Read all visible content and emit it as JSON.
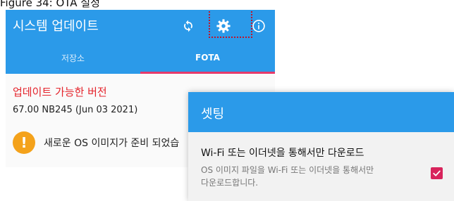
{
  "caption": "Figure 34: OTA 설정",
  "app": {
    "title": "시스템 업데이트",
    "icons": [
      "sync-icon",
      "settings-icon",
      "info-icon"
    ],
    "tabs": [
      {
        "label": "저장소",
        "selected": false
      },
      {
        "label": "FOTA",
        "selected": true
      }
    ],
    "section_title": "업데이트 가능한 버전",
    "version": "67.00 NB245 (Jun 03 2021)",
    "notice": "새로운 OS 이미지가 준비 되었습",
    "notice_icon": "exclamation-icon"
  },
  "dialog": {
    "title": "셋팅",
    "pref_title": "Wi-Fi 또는 이더넷을 통해서만 다운로드",
    "pref_summary_line1": "OS 이미지 파일을 Wi-Fi 또는 이더넷을 통해서만",
    "pref_summary_line2": "다운로드합니다.",
    "checked": true
  },
  "colors": {
    "primary": "#2b9ae9",
    "accent": "#e63a6b",
    "error_text": "#e4232b",
    "warning": "#f4a21b",
    "highlight_box": "#c0132a"
  }
}
